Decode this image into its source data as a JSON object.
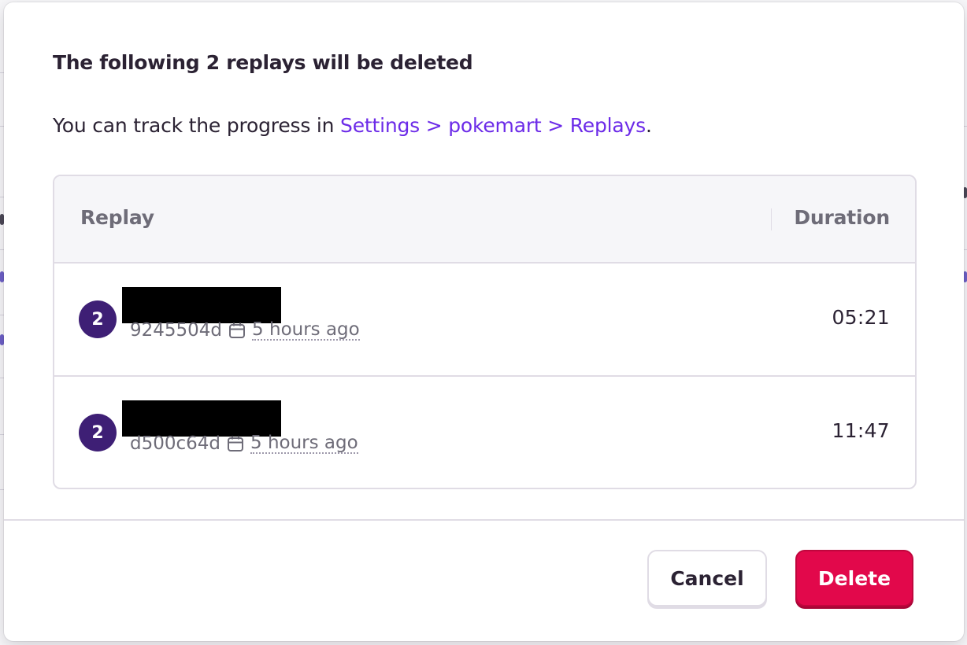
{
  "modal": {
    "title": "The following 2 replays will be deleted",
    "description_prefix": "You can track the progress in ",
    "description_link": "Settings > pokemart > Replays",
    "description_suffix": "."
  },
  "table": {
    "columns": {
      "replay": "Replay",
      "duration": "Duration"
    },
    "rows": [
      {
        "avatar": "2",
        "id": "9245504d",
        "time_ago": "5 hours ago",
        "duration": "05:21"
      },
      {
        "avatar": "2",
        "id": "d500c64d",
        "time_ago": "5 hours ago",
        "duration": "11:47"
      }
    ]
  },
  "buttons": {
    "cancel": "Cancel",
    "delete": "Delete"
  },
  "colors": {
    "link": "#6c2be8",
    "avatar": "#3e1f75",
    "delete_button": "#e2084b",
    "text": "#2b2233",
    "muted_text": "#6e6c78",
    "border": "#e0dce5"
  },
  "icons": {
    "date": "calendar-icon"
  }
}
